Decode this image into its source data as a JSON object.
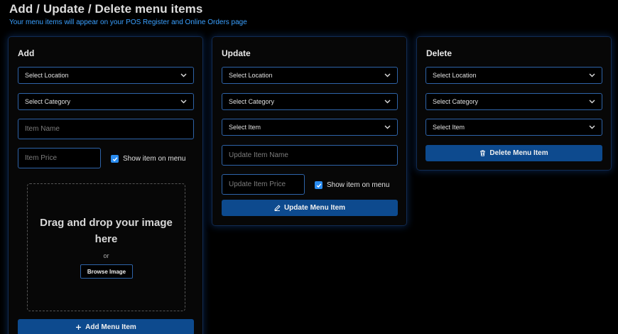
{
  "page": {
    "title": "Add / Update / Delete menu items",
    "subtitle": "Your menu items will appear on your POS Register and Online Orders page"
  },
  "add": {
    "title": "Add",
    "location_select": "Select Location",
    "category_select": "Select Category",
    "item_name_placeholder": "Item Name",
    "item_price_placeholder": "Item Price",
    "show_on_menu_label": "Show item on menu",
    "show_on_menu_checked": true,
    "dropzone_text": "Drag and drop your image here",
    "dropzone_or": "or",
    "browse_label": "Browse Image",
    "submit_label": "Add Menu Item",
    "submit_icon": "plus-icon"
  },
  "update": {
    "title": "Update",
    "location_select": "Select Location",
    "category_select": "Select Category",
    "item_select": "Select Item",
    "item_name_placeholder": "Update Item Name",
    "item_price_placeholder": "Update Item Price",
    "show_on_menu_label": "Show item on menu",
    "show_on_menu_checked": true,
    "submit_label": "Update Menu Item",
    "submit_icon": "pencil-icon"
  },
  "delete": {
    "title": "Delete",
    "location_select": "Select Location",
    "category_select": "Select Category",
    "item_select": "Select Item",
    "submit_label": "Delete Menu Item",
    "submit_icon": "trash-icon"
  },
  "colors": {
    "accent": "#3aa0ff",
    "button": "#0d4a8e",
    "border": "#2e63a8",
    "background": "#000000"
  }
}
